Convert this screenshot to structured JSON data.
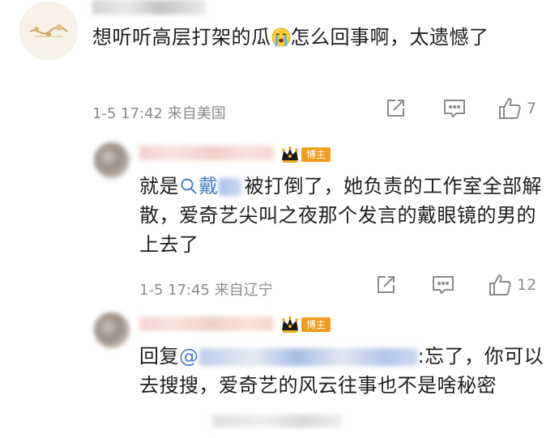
{
  "main_comment": {
    "text_a": "想听听高层打架的瓜",
    "text_b": "怎么回事啊，太遗憾了",
    "time": "1-5 17:42",
    "location": "来自美国",
    "like_count": "7"
  },
  "replies": [
    {
      "badge": "博主",
      "text_prefix": "就是",
      "text_search_link": "戴",
      "text_suffix": "被打倒了，她负责的工作室全部解散，爱奇艺尖叫之夜那个发言的戴眼镜的男的上去了",
      "time": "1-5 17:45",
      "location": "来自辽宁",
      "like_count": "12"
    },
    {
      "badge": "博主",
      "text_prefix": "回复",
      "mention_start": "@",
      "text_suffix": ":忘了，你可以去搜搜，爱奇艺的风云往事也不是啥秘密"
    }
  ],
  "colors": {
    "link": "#4a7cc9",
    "badge": "#f09c1e",
    "meta": "#8b8b8b",
    "text": "#1d1d1d"
  },
  "icons": [
    "share-icon",
    "comment-icon",
    "like-icon",
    "crown-icon",
    "search-icon",
    "crying-emoji"
  ]
}
